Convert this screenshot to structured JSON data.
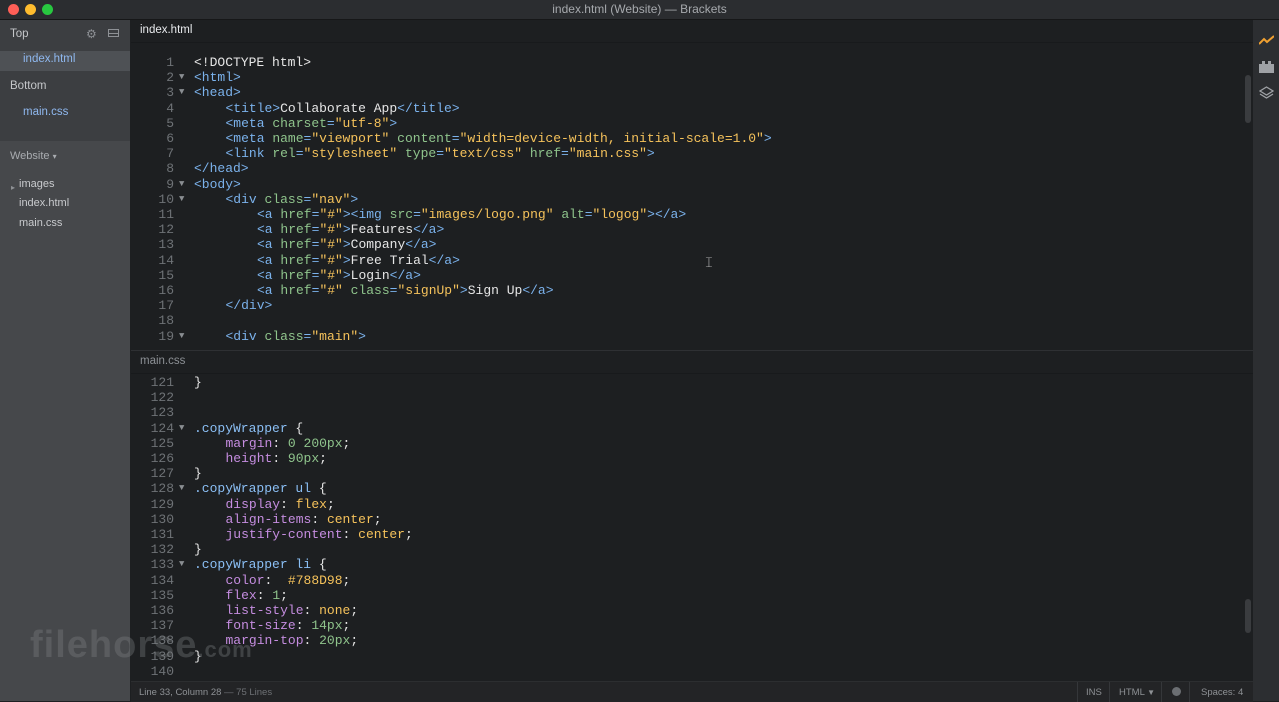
{
  "window": {
    "title": "index.html (Website) — Brackets"
  },
  "working_files": {
    "top_label": "Top",
    "top_files": [
      "index.html"
    ],
    "bottom_label": "Bottom",
    "bottom_files": [
      "main.css"
    ]
  },
  "project": {
    "name": "Website",
    "tree": [
      {
        "label": "images",
        "type": "folder"
      },
      {
        "label": "index.html",
        "type": "file"
      },
      {
        "label": "main.css",
        "type": "file"
      }
    ]
  },
  "panes": {
    "top": {
      "filename": "index.html",
      "lines": [
        {
          "n": 1,
          "fold": false,
          "tokens": [
            [
              "t-text",
              "<!DOCTYPE html>"
            ]
          ]
        },
        {
          "n": 2,
          "fold": true,
          "tokens": [
            [
              "t-tag",
              "<html>"
            ]
          ]
        },
        {
          "n": 3,
          "fold": true,
          "tokens": [
            [
              "t-tag",
              "<head>"
            ]
          ]
        },
        {
          "n": 4,
          "fold": false,
          "indent": 1,
          "tokens": [
            [
              "t-tag",
              "<title>"
            ],
            [
              "t-text",
              "Collaborate App"
            ],
            [
              "t-tag",
              "</title>"
            ]
          ]
        },
        {
          "n": 5,
          "fold": false,
          "indent": 1,
          "tokens": [
            [
              "t-tag",
              "<meta "
            ],
            [
              "t-attr",
              "charset"
            ],
            [
              "t-tag",
              "="
            ],
            [
              "t-str",
              "\"utf-8\""
            ],
            [
              "t-tag",
              ">"
            ]
          ]
        },
        {
          "n": 6,
          "fold": false,
          "indent": 1,
          "tokens": [
            [
              "t-tag",
              "<meta "
            ],
            [
              "t-attr",
              "name"
            ],
            [
              "t-tag",
              "="
            ],
            [
              "t-str",
              "\"viewport\""
            ],
            [
              "t-tag",
              " "
            ],
            [
              "t-attr",
              "content"
            ],
            [
              "t-tag",
              "="
            ],
            [
              "t-str",
              "\"width=device-width, initial-scale=1.0\""
            ],
            [
              "t-tag",
              ">"
            ]
          ]
        },
        {
          "n": 7,
          "fold": false,
          "indent": 1,
          "tokens": [
            [
              "t-tag",
              "<link "
            ],
            [
              "t-attr",
              "rel"
            ],
            [
              "t-tag",
              "="
            ],
            [
              "t-str",
              "\"stylesheet\""
            ],
            [
              "t-tag",
              " "
            ],
            [
              "t-attr",
              "type"
            ],
            [
              "t-tag",
              "="
            ],
            [
              "t-str",
              "\"text/css\""
            ],
            [
              "t-tag",
              " "
            ],
            [
              "t-attr",
              "href"
            ],
            [
              "t-tag",
              "="
            ],
            [
              "t-str",
              "\"main.css\""
            ],
            [
              "t-tag",
              ">"
            ]
          ]
        },
        {
          "n": 8,
          "fold": false,
          "tokens": [
            [
              "t-tag",
              "</head>"
            ]
          ]
        },
        {
          "n": 9,
          "fold": true,
          "tokens": [
            [
              "t-tag",
              "<body>"
            ]
          ]
        },
        {
          "n": 10,
          "fold": true,
          "indent": 1,
          "tokens": [
            [
              "t-tag",
              "<div "
            ],
            [
              "t-attr",
              "class"
            ],
            [
              "t-tag",
              "="
            ],
            [
              "t-str",
              "\"nav\""
            ],
            [
              "t-tag",
              ">"
            ]
          ]
        },
        {
          "n": 11,
          "fold": false,
          "indent": 2,
          "tokens": [
            [
              "t-tag",
              "<a "
            ],
            [
              "t-attr",
              "href"
            ],
            [
              "t-tag",
              "="
            ],
            [
              "t-str",
              "\"#\""
            ],
            [
              "t-tag",
              "><img "
            ],
            [
              "t-attr",
              "src"
            ],
            [
              "t-tag",
              "="
            ],
            [
              "t-str",
              "\"images/logo.png\""
            ],
            [
              "t-tag",
              " "
            ],
            [
              "t-attr",
              "alt"
            ],
            [
              "t-tag",
              "="
            ],
            [
              "t-str",
              "\"logog\""
            ],
            [
              "t-tag",
              "></a>"
            ]
          ]
        },
        {
          "n": 12,
          "fold": false,
          "indent": 2,
          "tokens": [
            [
              "t-tag",
              "<a "
            ],
            [
              "t-attr",
              "href"
            ],
            [
              "t-tag",
              "="
            ],
            [
              "t-str",
              "\"#\""
            ],
            [
              "t-tag",
              ">"
            ],
            [
              "t-text",
              "Features"
            ],
            [
              "t-tag",
              "</a>"
            ]
          ]
        },
        {
          "n": 13,
          "fold": false,
          "indent": 2,
          "tokens": [
            [
              "t-tag",
              "<a "
            ],
            [
              "t-attr",
              "href"
            ],
            [
              "t-tag",
              "="
            ],
            [
              "t-str",
              "\"#\""
            ],
            [
              "t-tag",
              ">"
            ],
            [
              "t-text",
              "Company"
            ],
            [
              "t-tag",
              "</a>"
            ]
          ]
        },
        {
          "n": 14,
          "fold": false,
          "indent": 2,
          "tokens": [
            [
              "t-tag",
              "<a "
            ],
            [
              "t-attr",
              "href"
            ],
            [
              "t-tag",
              "="
            ],
            [
              "t-str",
              "\"#\""
            ],
            [
              "t-tag",
              ">"
            ],
            [
              "t-text",
              "Free Trial"
            ],
            [
              "t-tag",
              "</a>"
            ]
          ]
        },
        {
          "n": 15,
          "fold": false,
          "indent": 2,
          "tokens": [
            [
              "t-tag",
              "<a "
            ],
            [
              "t-attr",
              "href"
            ],
            [
              "t-tag",
              "="
            ],
            [
              "t-str",
              "\"#\""
            ],
            [
              "t-tag",
              ">"
            ],
            [
              "t-text",
              "Login"
            ],
            [
              "t-tag",
              "</a>"
            ]
          ]
        },
        {
          "n": 16,
          "fold": false,
          "indent": 2,
          "tokens": [
            [
              "t-tag",
              "<a "
            ],
            [
              "t-attr",
              "href"
            ],
            [
              "t-tag",
              "="
            ],
            [
              "t-str",
              "\"#\""
            ],
            [
              "t-tag",
              " "
            ],
            [
              "t-attr",
              "class"
            ],
            [
              "t-tag",
              "="
            ],
            [
              "t-str",
              "\"signUp\""
            ],
            [
              "t-tag",
              ">"
            ],
            [
              "t-text",
              "Sign Up"
            ],
            [
              "t-tag",
              "</a>"
            ]
          ]
        },
        {
          "n": 17,
          "fold": false,
          "indent": 1,
          "tokens": [
            [
              "t-tag",
              "</div>"
            ]
          ]
        },
        {
          "n": 18,
          "fold": false,
          "tokens": []
        },
        {
          "n": 19,
          "fold": true,
          "indent": 1,
          "tokens": [
            [
              "t-tag",
              "<div "
            ],
            [
              "t-attr",
              "class"
            ],
            [
              "t-tag",
              "="
            ],
            [
              "t-str",
              "\"main\""
            ],
            [
              "t-tag",
              ">"
            ]
          ]
        }
      ]
    },
    "bottom": {
      "filename": "main.css",
      "lines": [
        {
          "n": 121,
          "fold": false,
          "tokens": [
            [
              "t-punc",
              "}"
            ]
          ]
        },
        {
          "n": 122,
          "fold": false,
          "tokens": []
        },
        {
          "n": 123,
          "fold": false,
          "tokens": []
        },
        {
          "n": 124,
          "fold": true,
          "tokens": [
            [
              "t-sel",
              ".copyWrapper"
            ],
            [
              "t-punc",
              " {"
            ]
          ]
        },
        {
          "n": 125,
          "fold": false,
          "indent": 1,
          "tokens": [
            [
              "t-prop",
              "margin"
            ],
            [
              "t-punc",
              ": "
            ],
            [
              "t-num",
              "0 200px"
            ],
            [
              "t-punc",
              ";"
            ]
          ]
        },
        {
          "n": 126,
          "fold": false,
          "indent": 1,
          "tokens": [
            [
              "t-prop",
              "height"
            ],
            [
              "t-punc",
              ": "
            ],
            [
              "t-num",
              "90px"
            ],
            [
              "t-punc",
              ";"
            ]
          ]
        },
        {
          "n": 127,
          "fold": false,
          "tokens": [
            [
              "t-punc",
              "}"
            ]
          ]
        },
        {
          "n": 128,
          "fold": true,
          "tokens": [
            [
              "t-sel",
              ".copyWrapper ul"
            ],
            [
              "t-punc",
              " {"
            ]
          ]
        },
        {
          "n": 129,
          "fold": false,
          "indent": 1,
          "tokens": [
            [
              "t-prop",
              "display"
            ],
            [
              "t-punc",
              ": "
            ],
            [
              "t-str",
              "flex"
            ],
            [
              "t-punc",
              ";"
            ]
          ]
        },
        {
          "n": 130,
          "fold": false,
          "indent": 1,
          "tokens": [
            [
              "t-prop",
              "align-items"
            ],
            [
              "t-punc",
              ": "
            ],
            [
              "t-str",
              "center"
            ],
            [
              "t-punc",
              ";"
            ]
          ]
        },
        {
          "n": 131,
          "fold": false,
          "indent": 1,
          "tokens": [
            [
              "t-prop",
              "justify-content"
            ],
            [
              "t-punc",
              ": "
            ],
            [
              "t-str",
              "center"
            ],
            [
              "t-punc",
              ";"
            ]
          ]
        },
        {
          "n": 132,
          "fold": false,
          "tokens": [
            [
              "t-punc",
              "}"
            ]
          ]
        },
        {
          "n": 133,
          "fold": true,
          "tokens": [
            [
              "t-sel",
              ".copyWrapper li"
            ],
            [
              "t-punc",
              " {"
            ]
          ]
        },
        {
          "n": 134,
          "fold": false,
          "indent": 1,
          "tokens": [
            [
              "t-prop",
              "color"
            ],
            [
              "t-punc",
              ":  "
            ],
            [
              "t-str",
              "#788D98"
            ],
            [
              "t-punc",
              ";"
            ]
          ]
        },
        {
          "n": 135,
          "fold": false,
          "indent": 1,
          "tokens": [
            [
              "t-prop",
              "flex"
            ],
            [
              "t-punc",
              ": "
            ],
            [
              "t-num",
              "1"
            ],
            [
              "t-punc",
              ";"
            ]
          ]
        },
        {
          "n": 136,
          "fold": false,
          "indent": 1,
          "tokens": [
            [
              "t-prop",
              "list-style"
            ],
            [
              "t-punc",
              ": "
            ],
            [
              "t-str",
              "none"
            ],
            [
              "t-punc",
              ";"
            ]
          ]
        },
        {
          "n": 137,
          "fold": false,
          "indent": 1,
          "tokens": [
            [
              "t-prop",
              "font-size"
            ],
            [
              "t-punc",
              ": "
            ],
            [
              "t-num",
              "14px"
            ],
            [
              "t-punc",
              ";"
            ]
          ]
        },
        {
          "n": 138,
          "fold": false,
          "indent": 1,
          "tokens": [
            [
              "t-prop",
              "margin-top"
            ],
            [
              "t-punc",
              ": "
            ],
            [
              "t-num",
              "20px"
            ],
            [
              "t-punc",
              ";"
            ]
          ]
        },
        {
          "n": 139,
          "fold": false,
          "tokens": [
            [
              "t-punc",
              "}"
            ]
          ]
        },
        {
          "n": 140,
          "fold": false,
          "tokens": []
        }
      ]
    }
  },
  "status": {
    "cursor": "Line 33, Column 28",
    "lines": "— 75 Lines",
    "ins": "INS",
    "mode": "HTML",
    "spaces": "Spaces: 4"
  },
  "toolbar_icons": [
    "live-preview-icon",
    "extension-manager-icon",
    "layers-icon"
  ],
  "watermark": {
    "main": "filehorse",
    "domain": ".com"
  }
}
